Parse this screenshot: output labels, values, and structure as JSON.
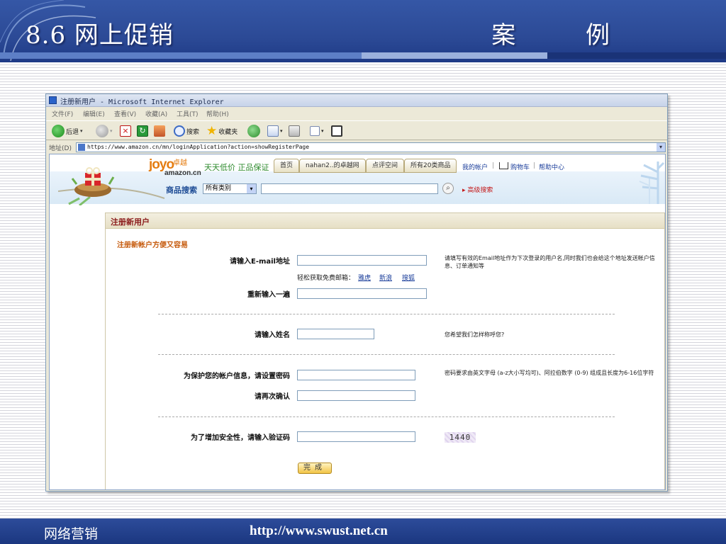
{
  "slide": {
    "title": "8.6  网上促销",
    "tag": "案 例",
    "footer_left": "网络营销",
    "footer_url": "http://www.swust.net.cn"
  },
  "colors": {
    "header_blue": "#2c4a96",
    "tab_beige": "#e8e1c5",
    "accent_orange": "#e57d12",
    "link_blue": "#1a3d9a",
    "heading_red": "#8b1a1a"
  },
  "browser": {
    "title": "注册新用户 - Microsoft Internet Explorer",
    "menu": [
      "文件(F)",
      "编辑(E)",
      "查看(V)",
      "收藏(A)",
      "工具(T)",
      "帮助(H)"
    ],
    "toolbar": {
      "back": "后退",
      "search": "搜索",
      "favorites": "收藏夹"
    },
    "address_label": "地址(D)",
    "address_url": "https://www.amazon.cn/mn/loginApplication?action=showRegisterPage"
  },
  "site": {
    "logo_joyo": "joyo",
    "logo_cn": "卓越",
    "logo_amazon": "amazon.cn",
    "slogan": "天天低价 正品保证",
    "tabs": [
      "首页",
      "nahan2..的卓越网",
      "点评空间",
      "所有20类商品"
    ],
    "top_links": {
      "account": "我的帐户",
      "cart": "购物车",
      "help": "帮助中心"
    },
    "search_label": "商品搜索",
    "category_selected": "所有类别",
    "advanced_search": "高级搜索"
  },
  "form": {
    "panel_title": "注册新用户",
    "subtitle": "注册新帐户方便又容易",
    "email_label": "请输入E-mail地址",
    "email_help": "请填写有效的Email地址作为下次登录的用户名,同时我们也会给这个地址发送帐户信息、订单通知等",
    "mail_tip": "轻松获取免费邮箱：",
    "mail_providers": [
      "雅虎",
      "新浪",
      "搜狐"
    ],
    "email_confirm_label": "重新输入一遍",
    "name_label": "请输入姓名",
    "name_help": "您希望我们怎样称呼您?",
    "password_label": "为保护您的帐户信息，请设置密码",
    "password_help": "密码要求由英文字母 (a-z大小写均可)、阿拉伯数字 (0-9) 组成且长度为6-16位字符",
    "password_confirm_label": "请再次确认",
    "captcha_label": "为了增加安全性，请输入验证码",
    "captcha_code": "1440",
    "submit": "完成"
  }
}
